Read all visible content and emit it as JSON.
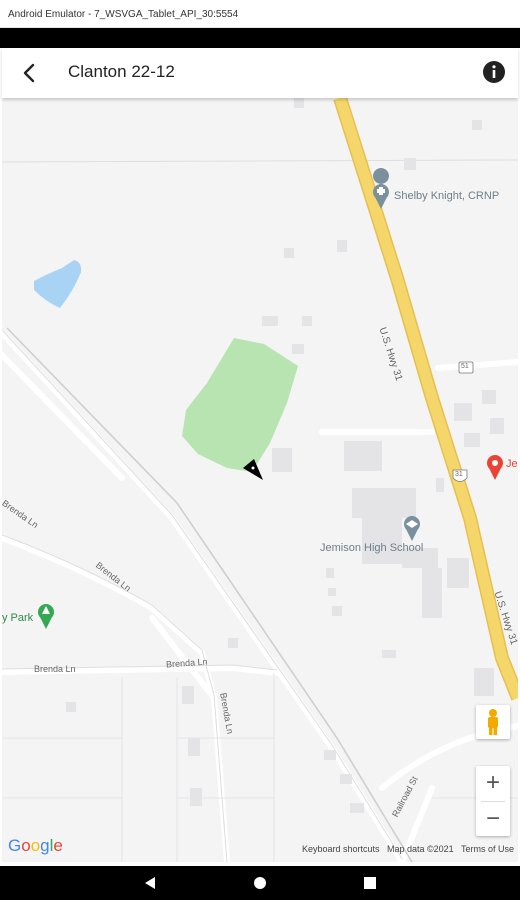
{
  "window": {
    "title": "Android Emulator - 7_WSVGA_Tablet_API_30:5554"
  },
  "app_bar": {
    "title": "Clanton 22-12",
    "back_icon": "arrow-back-icon",
    "info_icon": "info-icon"
  },
  "map": {
    "places": {
      "shelby_knight": "Shelby Knight, CRNP",
      "jemison_high": "Jemison High School",
      "park_partial": "y Park",
      "partial_red": "Je"
    },
    "roads": {
      "hwy31_upper": "U.S. Hwy 31",
      "hwy31_lower": "U.S. Hwy 31",
      "brenda_upper": "Brenda Ln",
      "brenda_mid": "Brenda Ln",
      "brenda_left": "Brenda Ln",
      "brenda_lower": "Brenda Ln",
      "brenda_vertical": "Brenda Ln",
      "railroad": "Railroad St",
      "shield_upper": "51",
      "shield_lower": "31"
    },
    "controls": {
      "zoom_in": "+",
      "zoom_out": "−",
      "pegman_icon": "pegman-icon"
    },
    "logo": [
      "G",
      "o",
      "o",
      "g",
      "l",
      "e"
    ],
    "logo_colors": [
      "#4285F4",
      "#EA4335",
      "#FBBC05",
      "#4285F4",
      "#34A853",
      "#EA4335"
    ],
    "attribution": {
      "keyboard": "Keyboard shortcuts",
      "map_data": "Map data ©2021",
      "terms": "Terms of Use"
    }
  },
  "colors": {
    "park": "#b7e4b0",
    "water": "#a9d3f5",
    "highway": "#f5d66b",
    "highway_edge": "#e6c04f",
    "pin_red": "#ea4335",
    "pin_green": "#34a853",
    "pin_gray": "#7b909d"
  }
}
